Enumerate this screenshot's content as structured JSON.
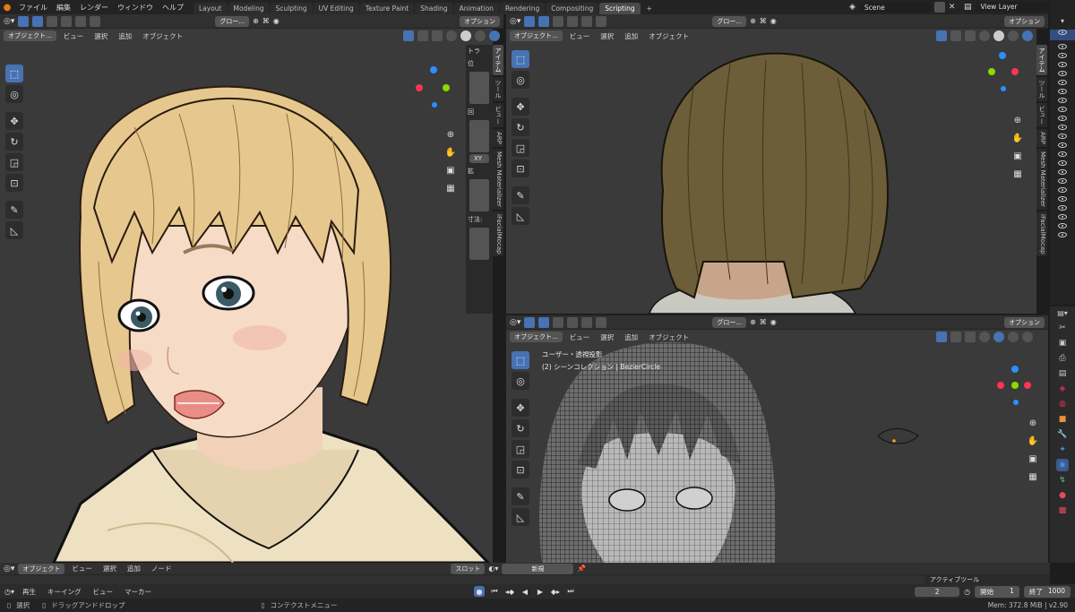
{
  "topbar": {
    "menus": [
      "ファイル",
      "編集",
      "レンダー",
      "ウィンドウ",
      "ヘルプ"
    ],
    "workspaces": [
      "Layout",
      "Modeling",
      "Sculpting",
      "UV Editing",
      "Texture Paint",
      "Shading",
      "Animation",
      "Rendering",
      "Compositing",
      "Scripting"
    ],
    "active_workspace": "Scripting",
    "add_tab": "+",
    "scene": "Scene",
    "view_layer": "View Layer"
  },
  "viewport_left": {
    "transform_orient": "グロー...",
    "options": "オプション",
    "mode": "オブジェクト...",
    "menus": [
      "ビュー",
      "選択",
      "追加",
      "オブジェクト"
    ],
    "npanel_tabs": [
      "アイテム",
      "ツール",
      "ビュー",
      "ARP",
      "Mesh Materializer",
      "iFacialMocap"
    ],
    "npanel_header": "トラ",
    "npanel_labels": [
      "位",
      "回",
      "XY",
      "拡",
      "寸法:"
    ]
  },
  "viewport_top_right": {
    "transform_orient": "グロー...",
    "options": "オプション",
    "mode": "オブジェクト...",
    "menus": [
      "ビュー",
      "選択",
      "追加",
      "オブジェクト"
    ],
    "npanel_tabs": [
      "アイテム",
      "ツール",
      "ビュー",
      "ARP",
      "Mesh Materializer",
      "iFacialMocap"
    ]
  },
  "viewport_bottom_right": {
    "transform_orient": "グロー...",
    "options": "オプション",
    "mode": "オブジェクト...",
    "menus": [
      "ビュー",
      "選択",
      "追加",
      "オブジェクト"
    ],
    "view_label": "ユーザー・透視投影",
    "collection_label": "(2) シーンコレクション | BezierCircle"
  },
  "shader_header": {
    "mode": "オブジェクト",
    "menus": [
      "ビュー",
      "選択",
      "追加",
      "ノード"
    ],
    "slot": "スロット",
    "new_button": "新規"
  },
  "active_tool": "アクティブツール",
  "timeline": {
    "playback": "再生",
    "keying": "キーイング",
    "view": "ビュー",
    "marker": "マーカー",
    "current_frame": "2",
    "start_label": "開始",
    "start_value": "1",
    "end_label": "終了",
    "end_value": "1000"
  },
  "status": {
    "select": "選択",
    "drag": "ドラッグアンドドロップ",
    "context_menu": "コンテクストメニュー",
    "memory": "Mem: 372.8 MiB | v2.90"
  },
  "colors": {
    "accent": "#4772b3",
    "viewport_bg": "#3a3a3a",
    "hair_blond": "#e6c88e",
    "hair_brown": "#6d5e3a",
    "skin": "#f6dcc6",
    "hoodie": "#eee1c1"
  },
  "icons": {
    "tools": [
      "select-box-icon",
      "cursor-icon",
      "move-icon",
      "rotate-icon",
      "scale-icon",
      "transform-icon",
      "annotate-icon",
      "measure-icon"
    ],
    "nav": [
      "zoom-icon",
      "hand-icon",
      "camera-icon",
      "grid-icon"
    ],
    "properties": [
      "tool-icon",
      "render-icon",
      "output-icon",
      "view-layer-icon",
      "scene-icon",
      "world-icon",
      "object-icon",
      "modifier-icon",
      "particles-icon",
      "physics-icon",
      "constraints-icon",
      "data-icon",
      "material-icon",
      "texture-icon"
    ]
  }
}
